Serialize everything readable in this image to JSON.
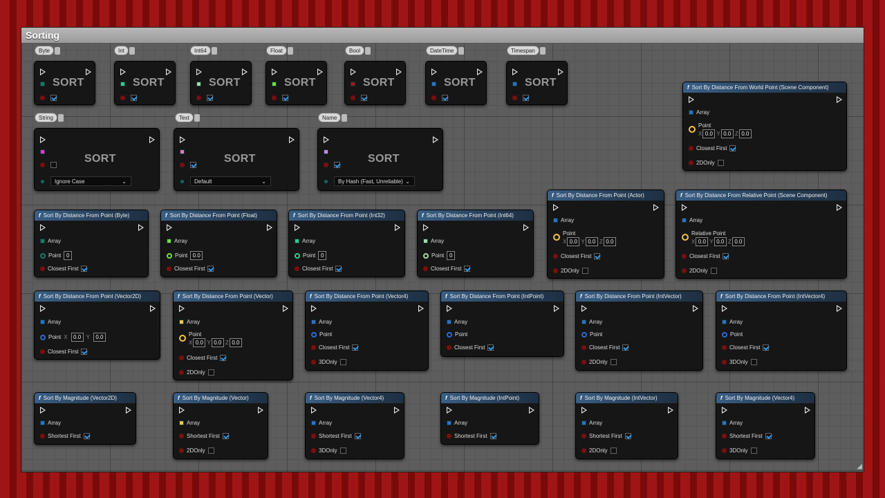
{
  "window": {
    "title": "Sorting"
  },
  "sort_label": "SORT",
  "tags": [
    "Byte",
    "Int",
    "Int64",
    "Float",
    "Bool",
    "DateTime",
    "Timespan",
    "String",
    "Text",
    "Name"
  ],
  "sort_dropdowns": {
    "string": "Ignore Case",
    "text": "Default",
    "name": "By Hash (Fast, Unreliable)"
  },
  "pins": {
    "array": "Array",
    "point": "Point",
    "relative_point": "Relative Point",
    "closest_first": "Closest First",
    "shortest_first": "Shortest First",
    "only2d": "2DOnly",
    "only3d": "3DOnly",
    "x": "X",
    "y": "Y",
    "z": "Z",
    "zero_int": "0",
    "zero_float": "0.0"
  },
  "colors": {
    "byte": "#1c7a66",
    "int": "#2ecf8e",
    "int64": "#a8d8a8",
    "float": "#6fe03a",
    "bool": "#9e1b1b",
    "datetime": "#2a72c9",
    "timespan": "#2a72c9",
    "string": "#e23cd0",
    "text": "#e07bb5",
    "name": "#c58ce0",
    "vector": "#f5c542",
    "struct": "#2a72c9"
  },
  "nodes": {
    "world_point": "Sort By Distance From World Point (Scene Component)",
    "actor": "Sort By Distance From Point (Actor)",
    "relative": "Sort By Distance From Relative Point (Scene Component)",
    "byte": "Sort By Distance From Point (Byte)",
    "float": "Sort By Distance From Point (Float)",
    "int32": "Sort By Distance From Point (Int32)",
    "int64": "Sort By Distance From Point (Int64)",
    "vector2d": "Sort By Distance From Point (Vector2D)",
    "vector": "Sort By Distance From Point (Vector)",
    "vector4": "Sort By Distance From Point (Vector4)",
    "intpoint": "Sort By Distance From Point (IntPoint)",
    "intvector": "Sort By Distance From Point (IntVector)",
    "intvector4": "Sort By Distance From Point (IntVector4)",
    "mag_vector2d": "Sort By Magnitude (Vector2D)",
    "mag_vector": "Sort By Magnitude (Vector)",
    "mag_vector4": "Sort By Magnitude (Vector4)",
    "mag_intpoint": "Sort By Magnitude (IntPoint)",
    "mag_intvector": "Sort By Magnitude (IntVector)",
    "mag_vector4b": "Sort By Magnitude (Vector4)"
  }
}
